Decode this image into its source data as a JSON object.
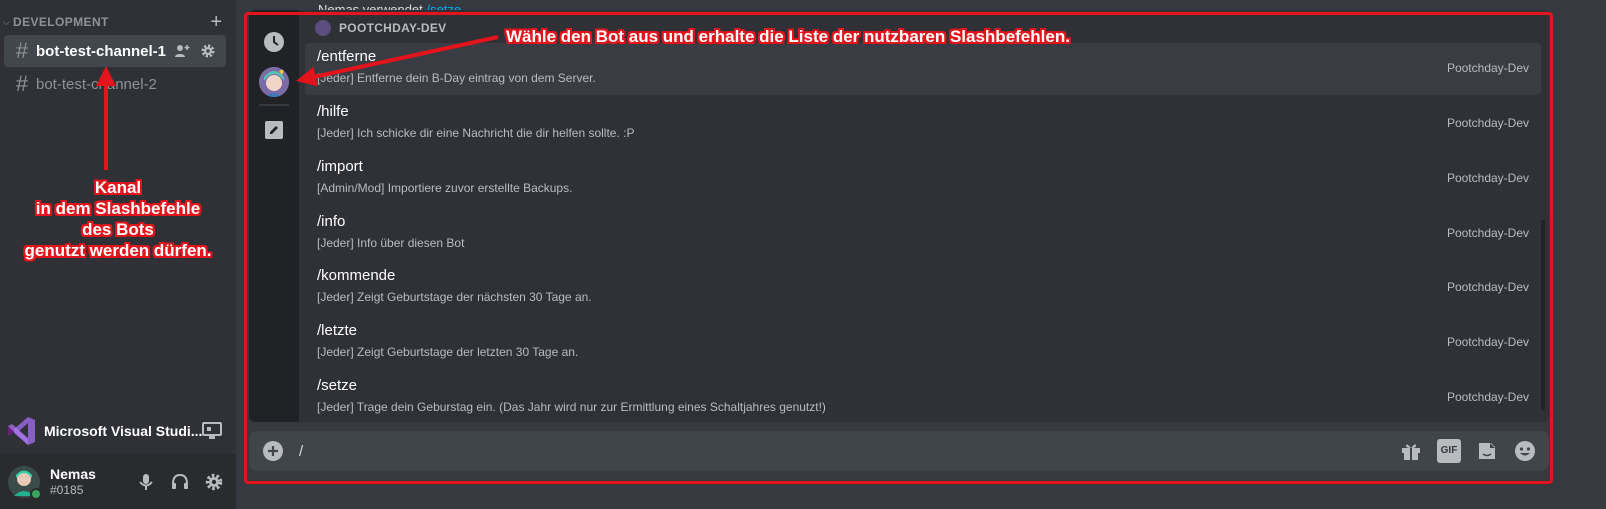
{
  "sidebar": {
    "category": "DEVELOPMENT",
    "channels": [
      {
        "name": "bot-test-channel-1",
        "active": true
      },
      {
        "name": "bot-test-channel-2",
        "active": false
      }
    ],
    "activity": {
      "name": "Microsoft Visual Studi...",
      "icon": "visual-studio-logo"
    },
    "user": {
      "name": "Nemas",
      "tag": "#0185",
      "status_color": "#3ba55c"
    }
  },
  "previous_message": {
    "text": "Nemas verwendet",
    "command": "/setze"
  },
  "command_popup": {
    "section_label": "POOTCHDAY-DEV",
    "commands": [
      {
        "name": "/entferne",
        "description": "[Jeder] Entferne dein B-Day eintrag von dem Server.",
        "app": "Pootchday-Dev",
        "selected": true
      },
      {
        "name": "/hilfe",
        "description": "[Jeder] Ich schicke dir eine Nachricht die dir helfen sollte. :P",
        "app": "Pootchday-Dev"
      },
      {
        "name": "/import",
        "description": "[Admin/Mod] Importiere zuvor erstellte Backups.",
        "app": "Pootchday-Dev"
      },
      {
        "name": "/info",
        "description": "[Jeder] Info über diesen Bot",
        "app": "Pootchday-Dev"
      },
      {
        "name": "/kommende",
        "description": "[Jeder] Zeigt Geburtstage der nächsten 30 Tage an.",
        "app": "Pootchday-Dev"
      },
      {
        "name": "/letzte",
        "description": "[Jeder] Zeigt Geburtstage der letzten 30 Tage an.",
        "app": "Pootchday-Dev"
      },
      {
        "name": "/setze",
        "description": "[Jeder] Trage dein Geburstag ein. (Das Jahr wird nur zur Ermittlung eines Schaltjahres genutzt!)",
        "app": "Pootchday-Dev"
      }
    ],
    "rail_icons": [
      "clock-icon",
      "bot-avatar",
      "pencil-icon"
    ]
  },
  "chat_input": {
    "value": "/"
  },
  "annotations": {
    "top": "Wähle den Bot aus und erhalte die Liste der nutzbaren Slashbefehlen.",
    "left_lines": [
      "Kanal",
      "in dem Slashbefehle",
      "des Bots",
      "genutzt werden dürfen."
    ],
    "color": "#e3141b"
  },
  "colors": {
    "accent_red": "#e3141b",
    "link": "#00aff4",
    "online": "#3ba55c"
  }
}
